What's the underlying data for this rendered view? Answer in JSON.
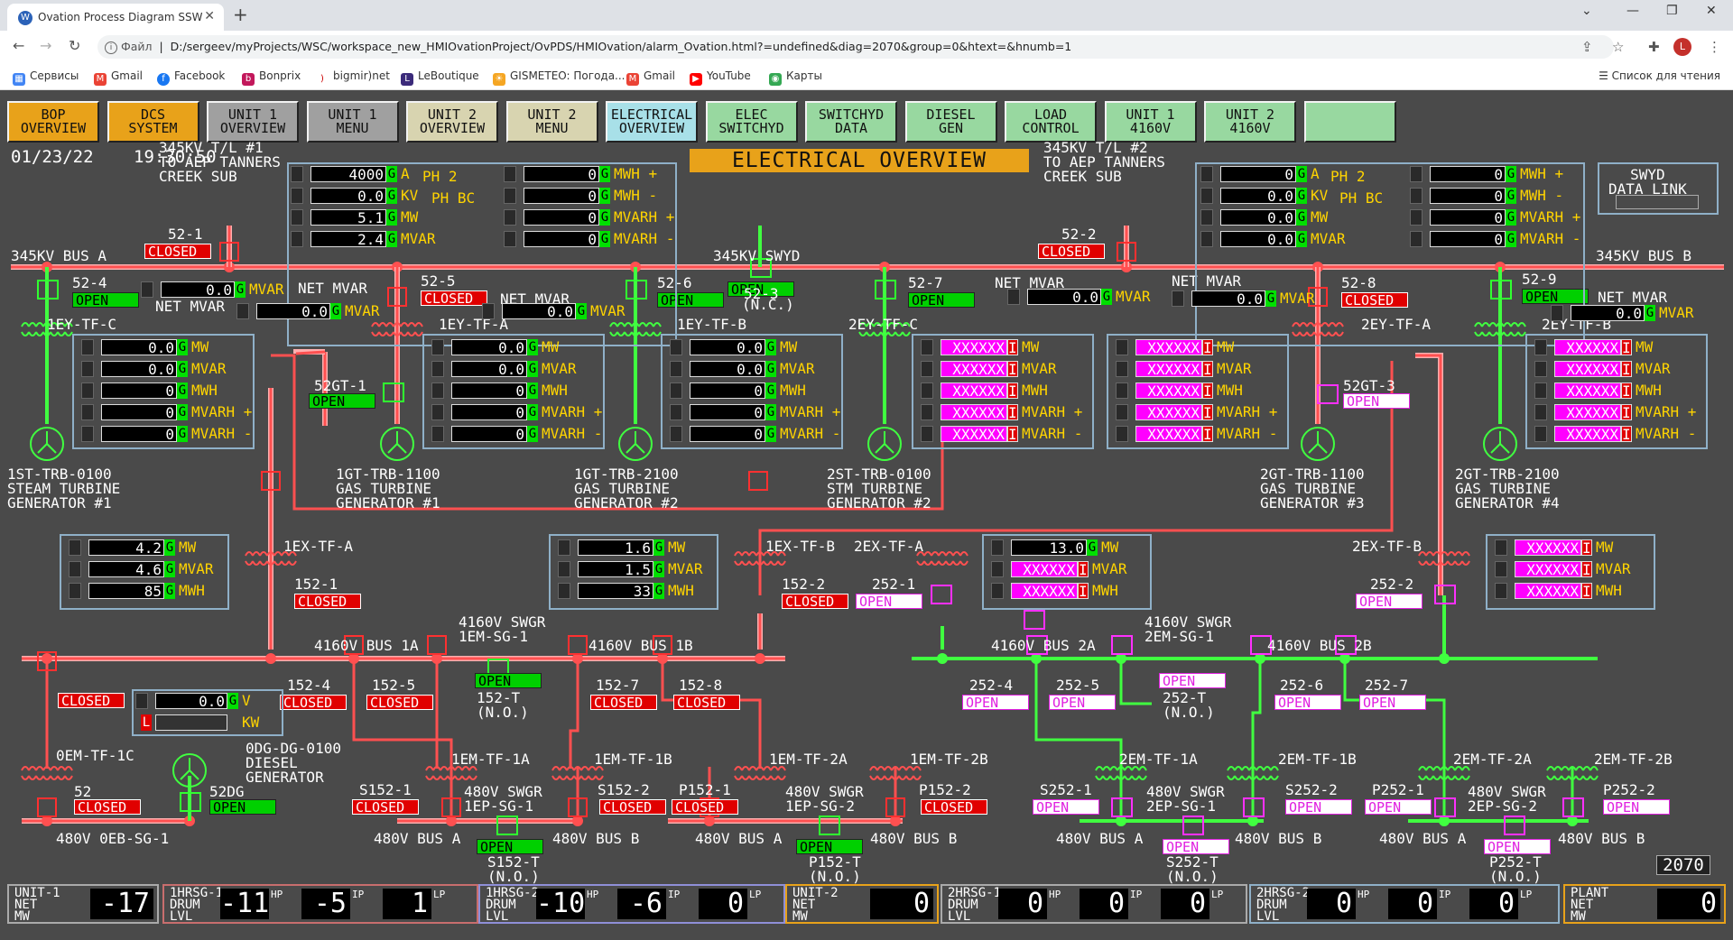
{
  "browser": {
    "tab_title": "Ovation Process Diagram SSW",
    "file_label": "Файл",
    "url": "D:/sergeev/myProjects/WSC/workspace_new_HMIOvationProject/OvPDS/HMIOvation/alarm_Ovation.html?=undefined&diag=2070&group=0&htext=&hnumb=1",
    "avatar": "L"
  },
  "bookmarks": [
    "Сервисы",
    "Gmail",
    "Facebook",
    "Bonprix",
    "bigmir)net",
    "LeBoutique",
    "GISMETEO: Погода...",
    "Gmail",
    "YouTube",
    "Карты"
  ],
  "reading_list": "Список для чтения",
  "nav_buttons": [
    {
      "label": "BOP\nOVERVIEW",
      "bg": "#e8a21a"
    },
    {
      "label": "DCS\nSYSTEM",
      "bg": "#e8a21a"
    },
    {
      "label": "UNIT 1\nOVERVIEW",
      "bg": "#a0a0a0"
    },
    {
      "label": "UNIT 1\nMENU",
      "bg": "#a0a0a0"
    },
    {
      "label": "UNIT 2\nOVERVIEW",
      "bg": "#d8d4b0"
    },
    {
      "label": "UNIT 2\nMENU",
      "bg": "#d8d4b0"
    },
    {
      "label": "ELECTRICAL\nOVERVIEW",
      "bg": "#a8e0e8"
    },
    {
      "label": "ELEC\nSWITCHYD",
      "bg": "#98d8a0"
    },
    {
      "label": "SWITCHYD\nDATA",
      "bg": "#98d8a0"
    },
    {
      "label": "DIESEL\nGEN",
      "bg": "#98d8a0"
    },
    {
      "label": "LOAD\nCONTROL",
      "bg": "#98d8a0"
    },
    {
      "label": "UNIT 1\n4160V",
      "bg": "#98d8a0"
    },
    {
      "label": "UNIT 2\n4160V",
      "bg": "#98d8a0"
    },
    {
      "label": "",
      "bg": "#98d8a0"
    }
  ],
  "header": {
    "date": "01/23/22",
    "time": "19:30:50",
    "title": "ELECTRICAL OVERVIEW",
    "swyd_link": "SWYD\nDATA LINK",
    "diagram_no": "2070"
  },
  "labels": {
    "tl1": "345KV T/L #1\nTO AEP TANNERS\nCREEK SUB",
    "tl2": "345KV T/L #2\nTO AEP TANNERS\nCREEK SUB",
    "busA": "345KV BUS A",
    "busB": "345KV BUS B",
    "swyd": "345KV SWYD",
    "ph2": "PH 2",
    "phbc": "PH BC",
    "tf_1eyc": "1EY-TF-C",
    "tf_1eya": "1EY-TF-A",
    "tf_1eyb": "1EY-TF-B",
    "tf_2eyc": "2EY-TF-C",
    "tf_2eya": "2EY-TF-A",
    "tf_2eyb": "2EY-TF-B",
    "netmvar": "NET MVAR",
    "gen1": "1ST-TRB-0100\nSTEAM TURBINE\nGENERATOR #1",
    "gen2": "1GT-TRB-1100\nGAS TURBINE\nGENERATOR #1",
    "gen3": "1GT-TRB-2100\nGAS TURBINE\nGENERATOR #2",
    "gen4": "2ST-TRB-0100\nSTM TURBINE\nGENERATOR #2",
    "gen5": "2GT-TRB-1100\nGAS TURBINE\nGENERATOR #3",
    "gen6": "2GT-TRB-2100\nGAS TURBINE\nGENERATOR #4",
    "ex1a": "1EX-TF-A",
    "ex1b": "1EX-TF-B",
    "ex2a": "2EX-TF-A",
    "ex2b": "2EX-TF-B",
    "b1a": "4160V BUS 1A",
    "b1b": "4160V BUS 1B",
    "b2a": "4160V BUS 2A",
    "b2b": "4160V BUS 2B",
    "swgr1": "4160V SWGR\n1EM-SG-1",
    "swgr2": "4160V SWGR\n2EM-SG-1",
    "t152": "152-T\n(N.O.)",
    "t252": "252-T\n(N.O.)",
    "oem": "0EM-TF-1C",
    "odg": "0DG-DG-0100\nDIESEL\nGENERATOR",
    "oeb": "480V 0EB-SG-1",
    "em1a": "1EM-TF-1A",
    "em1b": "1EM-TF-1B",
    "em2a": "1EM-TF-2A",
    "em2b": "1EM-TF-2B",
    "em3a": "2EM-TF-1A",
    "em3b": "2EM-TF-1B",
    "em4a": "2EM-TF-2A",
    "em4b": "2EM-TF-2B",
    "sg1": "480V SWGR\n1EP-SG-1",
    "sg2": "480V SWGR\n1EP-SG-2",
    "sg3": "480V SWGR\n2EP-SG-1",
    "sg4": "480V SWGR\n2EP-SG-2",
    "busa480": "480V BUS A",
    "busb480": "480V BUS B",
    "s152t": "S152-T\n(N.O.)",
    "p152t": "P152-T\n(N.O.)",
    "s252t": "S252-T\n(N.O.)",
    "p252t": "P252-T\n(N.O.)",
    "V": "V",
    "KW": "KW"
  },
  "units": {
    "a": "A",
    "kv": "KV",
    "mw": "MW",
    "mvar": "MVAR",
    "mwh": "MWH",
    "mwhp": "MWH +",
    "mwhm": "MWH -",
    "mvarhp": "MVARH +",
    "mvarhm": "MVARH -"
  },
  "breakers": [
    {
      "id": "52-1",
      "s": "CLOSED"
    },
    {
      "id": "52-2",
      "s": "CLOSED"
    },
    {
      "id": "52-4",
      "s": "OPEN"
    },
    {
      "id": "52-5",
      "s": "CLOSED"
    },
    {
      "id": "52-6",
      "s": "OPEN"
    },
    {
      "id": "52-3",
      "s": "OPEN"
    },
    {
      "id": "52-7",
      "s": "OPEN"
    },
    {
      "id": "52-8",
      "s": "CLOSED"
    },
    {
      "id": "52-9",
      "s": "OPEN"
    },
    {
      "id": "52GT-1",
      "s": "OPEN"
    },
    {
      "id": "52GT-3",
      "s": "OPEN"
    },
    {
      "id": "152-1",
      "s": "CLOSED"
    },
    {
      "id": "152-2",
      "s": "CLOSED"
    },
    {
      "id": "252-1",
      "s": "OPEN"
    },
    {
      "id": "252-2",
      "s": "OPEN"
    },
    {
      "id": "152-T",
      "s": "OPEN"
    },
    {
      "id": "152-4",
      "s": "CLOSED"
    },
    {
      "id": "152-5",
      "s": "CLOSED"
    },
    {
      "id": "152-7",
      "s": "CLOSED"
    },
    {
      "id": "152-8",
      "s": "CLOSED"
    },
    {
      "id": "252-4",
      "s": "OPEN"
    },
    {
      "id": "252-5",
      "s": "OPEN"
    },
    {
      "id": "252-T",
      "s": "OPEN"
    },
    {
      "id": "252-6",
      "s": "OPEN"
    },
    {
      "id": "252-7",
      "s": "OPEN"
    },
    {
      "id": "0EM",
      "s": "CLOSED"
    },
    {
      "id": "52",
      "s": "CLOSED"
    },
    {
      "id": "52DG",
      "s": "OPEN"
    },
    {
      "id": "S152-1",
      "s": "CLOSED"
    },
    {
      "id": "S152-2",
      "s": "CLOSED"
    },
    {
      "id": "P152-1",
      "s": "CLOSED"
    },
    {
      "id": "P152-2",
      "s": "CLOSED"
    },
    {
      "id": "S152-T",
      "s": "OPEN"
    },
    {
      "id": "P152-T",
      "s": "OPEN"
    },
    {
      "id": "S252-1",
      "s": "OPEN"
    },
    {
      "id": "S252-2",
      "s": "OPEN"
    },
    {
      "id": "P252-1",
      "s": "OPEN"
    },
    {
      "id": "P252-2",
      "s": "OPEN"
    },
    {
      "id": "S252-T",
      "s": "OPEN"
    },
    {
      "id": "P252-T",
      "s": "OPEN"
    },
    {
      "id": "52-3nc",
      "s": "(N.C.)"
    }
  ],
  "tl1_vals": [
    "4000",
    "0.0",
    "5.1",
    "2.4",
    "0",
    "0",
    "0",
    "0"
  ],
  "tl2_vals": [
    "0",
    "0.0",
    "0.0",
    "0.0",
    "0",
    "0",
    "0",
    "0"
  ],
  "net_mvar": [
    "0.0",
    "0.0",
    "0.0",
    "0.0",
    "0.0",
    "0.0"
  ],
  "gen_vals": {
    "g1": [
      "0.0",
      "0.0",
      "0",
      "0",
      "0"
    ],
    "g2": [
      "0.0",
      "0.0",
      "0",
      "0",
      "0"
    ],
    "g3": [
      "0.0",
      "0.0",
      "0",
      "0",
      "0"
    ],
    "g4": [
      "XXXXXX",
      "XXXXXX",
      "XXXXXX",
      "XXXXXX",
      "XXXXXX"
    ],
    "g5": [
      "XXXXXX",
      "XXXXXX",
      "XXXXXX",
      "XXXXXX",
      "XXXXXX"
    ],
    "g6": [
      "XXXXXX",
      "XXXXXX",
      "XXXXXX",
      "XXXXXX",
      "XXXXXX"
    ]
  },
  "ex_vals": {
    "e1": [
      "4.2",
      "4.6",
      "85"
    ],
    "e2": [
      "1.6",
      "1.5",
      "33"
    ],
    "e3": [
      "13.0",
      "XXXXXX",
      "XXXXXX"
    ],
    "e4": [
      "XXXXXX",
      "XXXXXX",
      "XXXXXX"
    ]
  },
  "diesel": [
    "0.0",
    ""
  ],
  "q": "G",
  "bottom": [
    {
      "label": "UNIT-1\nNET\nMW",
      "val": "-17"
    },
    {
      "label": "1HRSG-1\nDRUM\nLVL",
      "v1": "-11",
      "v2": "-5",
      "v3": "1",
      "m1": "HP",
      "m2": "IP",
      "m3": "LP"
    },
    {
      "label": "1HRSG-2\nDRUM\nLVL",
      "v1": "-10",
      "v2": "-6",
      "v3": "0",
      "m1": "HP",
      "m2": "IP",
      "m3": "LP"
    },
    {
      "label": "UNIT-2\nNET\nMW",
      "val": "0"
    },
    {
      "label": "2HRSG-1\nDRUM\nLVL",
      "v1": "0",
      "v2": "0",
      "v3": "0",
      "m1": "HP",
      "m2": "IP",
      "m3": "LP"
    },
    {
      "label": "2HRSG-2\nDRUM\nLVL",
      "v1": "0",
      "v2": "0",
      "v3": "0",
      "m1": "HP",
      "m2": "IP",
      "m3": "LP"
    },
    {
      "label": "PLANT\nNET\nMW",
      "val": "0"
    }
  ],
  "colors": {
    "closed": "#e00000",
    "open": "#00d000",
    "bus_energized": "#ff4a4a",
    "bus_deenergized": "#40ff40",
    "bad_quality": "#ff00ff",
    "title_bg": "#e8a21a"
  }
}
